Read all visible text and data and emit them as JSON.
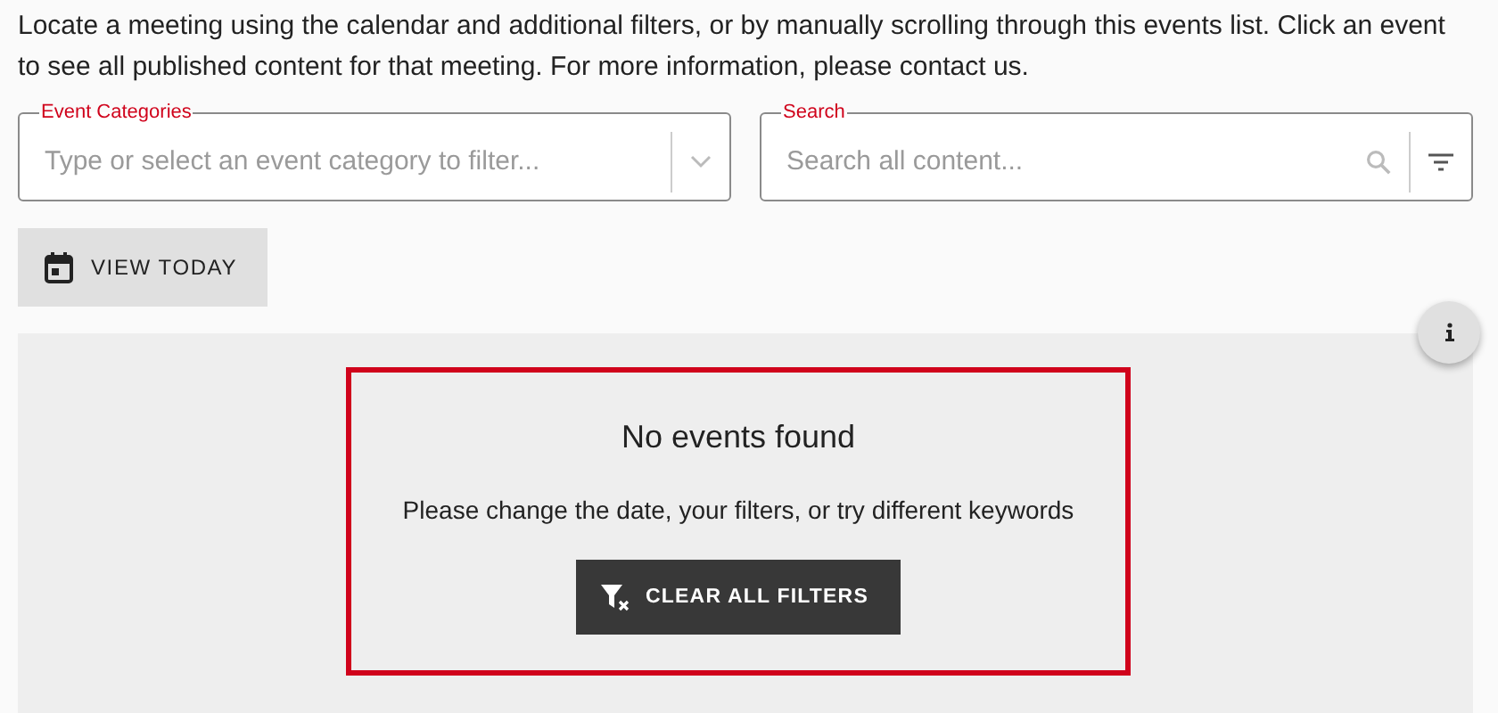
{
  "intro": "Locate a meeting using the calendar and additional filters, or by manually scrolling through this events list. Click an event to see all published content for that meeting. For more information, please contact us.",
  "category_field": {
    "label": "Event Categories",
    "placeholder": "Type or select an event category to filter..."
  },
  "search_field": {
    "label": "Search",
    "placeholder": "Search all content..."
  },
  "view_today_button": "VIEW TODAY",
  "empty_state": {
    "title": "No events found",
    "message": "Please change the date, your filters, or try different keywords",
    "button": "CLEAR ALL FILTERS"
  }
}
